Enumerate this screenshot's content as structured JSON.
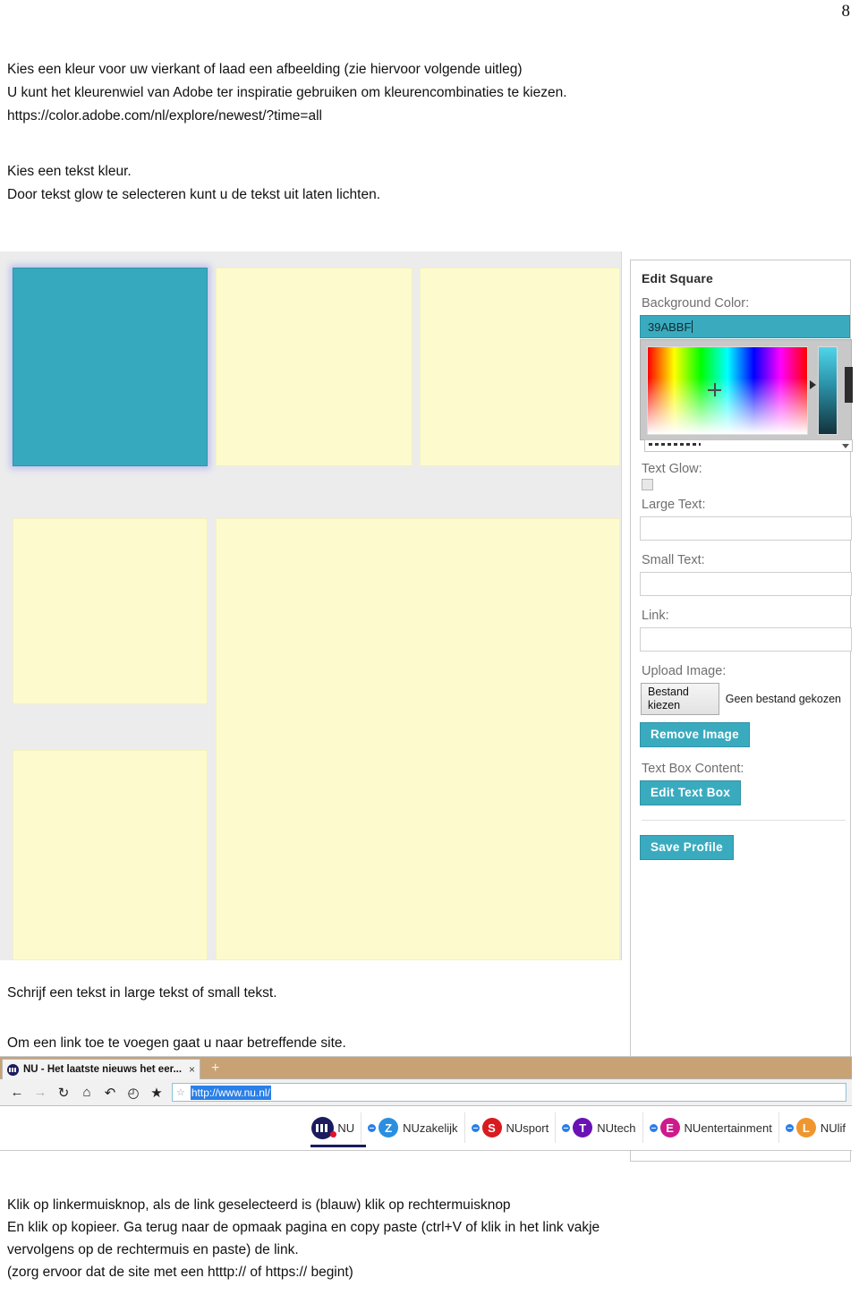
{
  "page": {
    "number": "8"
  },
  "document": {
    "top_paragraph": [
      "Kies een kleur voor uw vierkant of laad een afbeelding (zie hiervoor volgende uitleg)",
      "U kunt het kleurenwiel van Adobe ter inspiratie gebruiken om kleurencombinaties te kiezen.",
      "https://color.adobe.com/nl/explore/newest/?time=all"
    ],
    "mid_paragraph": [
      "Kies een tekst kleur.",
      "Door tekst glow te selecteren kunt u de tekst uit laten lichten."
    ],
    "schrijf_line": "Schrijf een tekst in large tekst of small tekst.",
    "link_line": "Om een link toe te voegen gaat u naar betreffende site.",
    "bottom_paragraph": [
      "Klik op linkermuisknop, als de link geselecteerd is (blauw) klik op rechtermuisknop",
      "En klik op kopieer. Ga terug naar de opmaak pagina en copy paste (ctrl+V of klik in het link vakje",
      "vervolgens op de rechtermuis en paste) de link.",
      "(zorg ervoor dat de site met een htttp:// of https:// begint)"
    ]
  },
  "editor": {
    "panel_title": "Edit Square",
    "background_color_label": "Background Color:",
    "background_color_value": "39ABBF",
    "text_glow_label": "Text Glow:",
    "text_glow_checked": false,
    "large_text_label": "Large Text:",
    "large_text_value": "",
    "small_text_label": "Small Text:",
    "small_text_value": "",
    "link_label": "Link:",
    "link_value": "",
    "upload_image_label": "Upload Image:",
    "choose_file_button": "Bestand kiezen",
    "file_status": "Geen bestand gekozen",
    "remove_image_button": "Remove Image",
    "text_box_content_label": "Text Box Content:",
    "edit_text_box_button": "Edit Text Box",
    "save_profile_button": "Save Profile",
    "accent_color": "#3AABBF"
  },
  "grid": {
    "selected_color": "#37A9BF",
    "tile_color": "#FDFBCD",
    "background": "#ECECEC"
  },
  "browser": {
    "tab_title": "NU - Het laatste nieuws het eer...",
    "tab_close_label": "×",
    "new_tab_label": "+",
    "nav_icons": [
      {
        "name": "back-icon",
        "glyph": "←",
        "dim": false
      },
      {
        "name": "forward-icon",
        "glyph": "→",
        "dim": true
      },
      {
        "name": "reload-icon",
        "glyph": "↻",
        "dim": false
      },
      {
        "name": "home-icon",
        "glyph": "⌂",
        "dim": false
      },
      {
        "name": "undo-icon",
        "glyph": "↶",
        "dim": false
      },
      {
        "name": "history-icon",
        "glyph": "◴",
        "dim": false
      },
      {
        "name": "bookmark-star-icon",
        "glyph": "★",
        "dim": false
      }
    ],
    "url_star_glyph": "☆",
    "url_value": "http://www.nu.nl/",
    "nu_nav": [
      {
        "label": "NU",
        "letter": "",
        "color": "#1B1B5E",
        "logo": true
      },
      {
        "label": "NUzakelijk",
        "letter": "Z",
        "color": "#2A8FE0",
        "logo": false
      },
      {
        "label": "NUsport",
        "letter": "S",
        "color": "#D91A20",
        "logo": false
      },
      {
        "label": "NUtech",
        "letter": "T",
        "color": "#6A12B4",
        "logo": false
      },
      {
        "label": "NUentertainment",
        "letter": "E",
        "color": "#CE1A8C",
        "logo": false
      },
      {
        "label": "NUlif",
        "letter": "L",
        "color": "#F0962E",
        "logo": false
      }
    ]
  }
}
